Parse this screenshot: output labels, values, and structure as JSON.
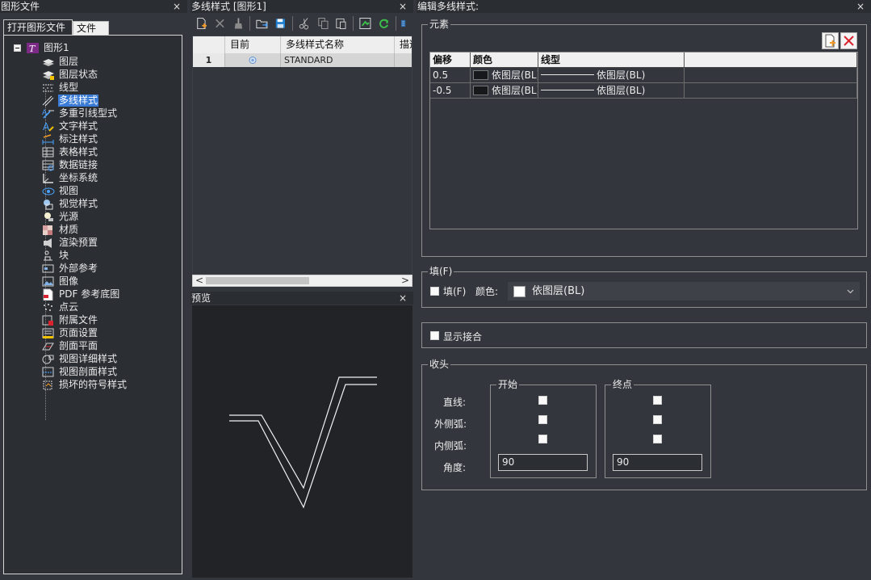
{
  "left_panel": {
    "title": "图形文件",
    "close_glyph": "×",
    "tabs": [
      {
        "label": "打开图形文件",
        "active": true
      },
      {
        "label": "文件夹",
        "active": false
      }
    ],
    "tree": {
      "root_label": "图形1",
      "items": [
        {
          "label": "图层",
          "icon": "layer-icon"
        },
        {
          "label": "图层状态",
          "icon": "layer-state-icon"
        },
        {
          "label": "线型",
          "icon": "linetype-icon"
        },
        {
          "label": "多线样式",
          "icon": "mline-style-icon",
          "selected": true
        },
        {
          "label": "多重引线型式",
          "icon": "mleader-style-icon"
        },
        {
          "label": "文字样式",
          "icon": "text-style-icon"
        },
        {
          "label": "标注样式",
          "icon": "dim-style-icon"
        },
        {
          "label": "表格样式",
          "icon": "table-style-icon"
        },
        {
          "label": "数据链接",
          "icon": "data-link-icon"
        },
        {
          "label": "坐标系统",
          "icon": "ucs-icon"
        },
        {
          "label": "视图",
          "icon": "view-icon"
        },
        {
          "label": "视觉样式",
          "icon": "visual-style-icon"
        },
        {
          "label": "光源",
          "icon": "light-icon"
        },
        {
          "label": "材质",
          "icon": "material-icon"
        },
        {
          "label": "渲染预置",
          "icon": "render-preset-icon"
        },
        {
          "label": "块",
          "icon": "block-icon"
        },
        {
          "label": "外部参考",
          "icon": "xref-icon"
        },
        {
          "label": "图像",
          "icon": "image-icon"
        },
        {
          "label": "PDF 参考底图",
          "icon": "pdf-icon"
        },
        {
          "label": "点云",
          "icon": "point-cloud-icon"
        },
        {
          "label": "附属文件",
          "icon": "attachment-icon"
        },
        {
          "label": "页面设置",
          "icon": "page-setup-icon"
        },
        {
          "label": "剖面平面",
          "icon": "section-plane-icon"
        },
        {
          "label": "视图详细样式",
          "icon": "detail-view-icon"
        },
        {
          "label": "视图剖面样式",
          "icon": "section-view-icon"
        },
        {
          "label": "损坏的符号样式",
          "icon": "broken-symbol-icon"
        }
      ]
    }
  },
  "middle_panel": {
    "title": "多线样式 [图形1]",
    "close_glyph": "×",
    "toolbar": [
      "new-icon",
      "delete-icon",
      "purge-icon",
      "open-icon",
      "save-icon",
      "cut-icon",
      "copy-icon",
      "paste-icon",
      "set-current-icon",
      "refresh-icon",
      "view-toggle-icon"
    ],
    "grid": {
      "columns": [
        "",
        "目前",
        "多线样式名称",
        "描述"
      ],
      "rows": [
        {
          "index": "1",
          "current": true,
          "name": "STANDARD",
          "desc": ""
        }
      ]
    },
    "scroll": {
      "left_arrow": "<",
      "right_arrow": ">"
    },
    "preview_title": "预览"
  },
  "right_panel": {
    "title": "编辑多线样式:",
    "close_glyph": "×",
    "elements_group": {
      "label": "元素",
      "columns": [
        "偏移",
        "颜色",
        "线型"
      ],
      "rows": [
        {
          "offset": "0.5",
          "color": "依图层(BL)",
          "linetype": "依图层(BL)"
        },
        {
          "offset": "-0.5",
          "color": "依图层(BL)",
          "linetype": "依图层(BL)"
        }
      ]
    },
    "fill_group": {
      "label": "填(F)",
      "checkbox_label": "填(F)",
      "color_label": "颜色:",
      "color_value": "依图层(BL)"
    },
    "show_joints_label": "显示接合",
    "caps_group": {
      "label": "收头",
      "start_label": "开始",
      "end_label": "终点",
      "row_labels": [
        "直线:",
        "外侧弧:",
        "内侧弧:",
        "角度:"
      ],
      "start_angle": "90",
      "end_angle": "90"
    },
    "colors": {
      "accent_selection": "#3a7bd5",
      "delete_red": "#d9232e"
    }
  }
}
